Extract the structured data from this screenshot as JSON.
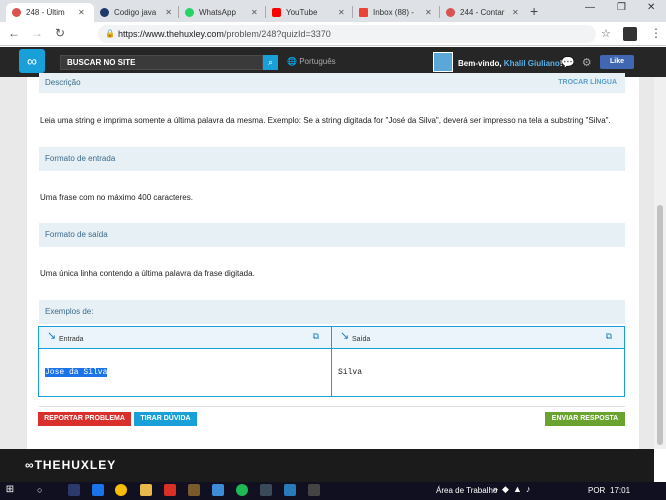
{
  "browser": {
    "tabs": [
      {
        "title": "248 - Últim",
        "active": true,
        "favicon_color": "#d9534f"
      },
      {
        "title": "Codigo java",
        "active": false,
        "favicon_color": "#1e3a6b"
      },
      {
        "title": "WhatsApp",
        "active": false,
        "favicon_color": "#25d366"
      },
      {
        "title": "YouTube",
        "active": false,
        "favicon_color": "#ff0000"
      },
      {
        "title": "Inbox (88) -",
        "active": false,
        "favicon_color": "#ea4335"
      },
      {
        "title": "244 - Contar",
        "active": false,
        "favicon_color": "#d9534f"
      }
    ],
    "new_tab": "+",
    "url_host": "https://www.thehuxley.com",
    "url_path": "/problem/248?quizId=3370"
  },
  "site": {
    "search_placeholder": "BUSCAR NO SITE",
    "language": "Português",
    "welcome_prefix": "Bem-vindo,",
    "user_name": "Khalil Giuliano",
    "welcome_suffix": "!",
    "fb_like": "Like"
  },
  "problem": {
    "description_label": "Descrição",
    "change_language": "TROCAR LÍNGUA",
    "description_text": "Leia uma string e imprima somente a última palavra da mesma. Exemplo: Se a string digitada for \"José da Silva\", deverá ser impresso na tela a substring \"Silva\".",
    "input_label": "Formato de entrada",
    "input_text": "Uma frase com no máximo 400 caracteres.",
    "output_label": "Formato de saída",
    "output_text": "Uma única linha contendo a última palavra da frase digitada.",
    "examples_label": "Exemplos de:",
    "example_input_label": "Entrada",
    "example_input_value": "Jose da Silva",
    "example_output_label": "Saída",
    "example_output_value": "Silva"
  },
  "actions": {
    "report": "REPORTAR PROBLEMA",
    "ask": "TIRAR DÚVIDA",
    "submit": "ENVIAR RESPOSTA"
  },
  "footer": {
    "logo": "THEHUXLEY"
  },
  "taskbar": {
    "area": "Área de Trabalho",
    "lang": "POR",
    "time": "17:01"
  },
  "colors": {
    "accent": "#1aa0d8",
    "report": "#d9302c",
    "ask": "#1aa0d8",
    "submit": "#6aa32f"
  }
}
